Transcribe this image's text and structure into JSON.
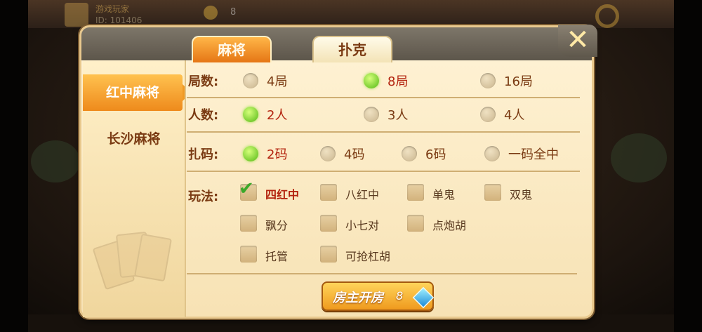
{
  "background": {
    "user_name": "游戏玩家",
    "user_id": "ID: 101406",
    "coins": "8"
  },
  "dialog": {
    "tabs": [
      {
        "label": "麻将",
        "active": true
      },
      {
        "label": "扑克",
        "active": false
      }
    ],
    "close_label": "✕",
    "game_types": [
      {
        "label": "红中麻将",
        "active": true
      },
      {
        "label": "长沙麻将",
        "active": false
      }
    ],
    "rounds": {
      "label": "局数:",
      "options": [
        "4局",
        "8局",
        "16局"
      ],
      "selected": "8局"
    },
    "players": {
      "label": "人数:",
      "options": [
        "2人",
        "3人",
        "4人"
      ],
      "selected": "2人"
    },
    "zhama": {
      "label": "扎码:",
      "options": [
        "2码",
        "4码",
        "6码",
        "一码全中"
      ],
      "selected": "2码"
    },
    "rules": {
      "label": "玩法:",
      "options": [
        {
          "label": "四红中",
          "checked": true
        },
        {
          "label": "八红中",
          "checked": false
        },
        {
          "label": "单鬼",
          "checked": false
        },
        {
          "label": "双鬼",
          "checked": false
        },
        {
          "label": "飘分",
          "checked": false
        },
        {
          "label": "小七对",
          "checked": false
        },
        {
          "label": "点炮胡",
          "checked": false
        },
        {
          "label": "托管",
          "checked": false
        },
        {
          "label": "可抢杠胡",
          "checked": false
        }
      ]
    },
    "create_button": {
      "label": "房主开房",
      "cost": "8",
      "icon": "diamond-icon"
    }
  },
  "colors": {
    "accent_orange": "#ef8a1c",
    "selected_green": "#52b814",
    "text_brown": "#7a3a12",
    "selected_red": "#b3220e"
  }
}
